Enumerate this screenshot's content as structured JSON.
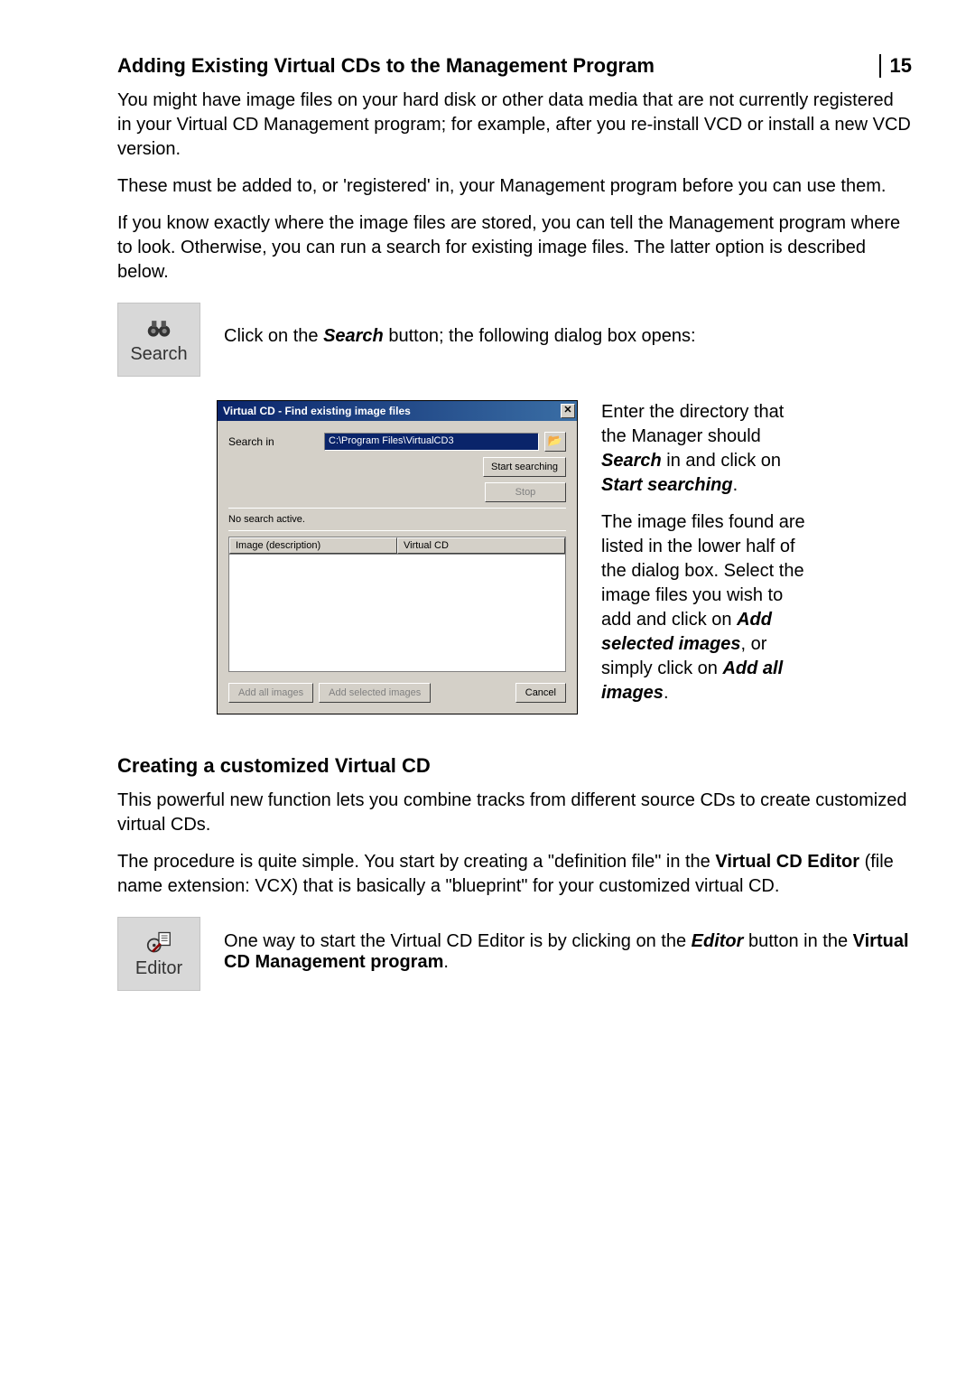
{
  "page": {
    "number": "15",
    "section1_title": "Adding Existing Virtual CDs to the Management Program",
    "section1_p1": "You might have image files on your hard disk or other data media that are not currently registered in your Virtual CD Management program; for example, after you re-install VCD or install a new VCD version.",
    "section1_p2": "These must be added to, or 'registered' in, your Management program before you can use them.",
    "section1_p3": "If you know exactly where the image files are stored, you can tell the Management program where to look. Otherwise, you can run a search for existing image files. The latter option is described below.",
    "search_button_label": "Search",
    "search_row_prefix": "Click on the ",
    "search_row_bold": "Search",
    "search_row_suffix": " button; the following dialog box opens:",
    "section2_title": "Creating a customized Virtual CD",
    "section2_p1": "This powerful new function lets you combine tracks from different source CDs to create customized virtual CDs.",
    "section2_p2a": "The procedure is quite simple. You start by creating a \"definition file\" in the ",
    "section2_p2b": "Virtual CD Editor",
    "section2_p2c": " (file name extension: VCX) that is basically a \"blueprint\" for your customized virtual CD.",
    "editor_button_label": "Editor",
    "editor_row_a": "One way to start the Virtual CD Editor is by clicking on the ",
    "editor_row_b": "Editor",
    "editor_row_c": " button in the ",
    "editor_row_d": "Virtual CD Management program",
    "editor_row_e": "."
  },
  "dialog": {
    "title": "Virtual CD - Find existing image files",
    "search_in_label": "Search in",
    "search_in_value": "C:\\Program Files\\VirtualCD3",
    "start_searching": "Start searching",
    "stop": "Stop",
    "status": "No search active.",
    "col1": "Image (description)",
    "col2": "Virtual CD",
    "add_all": "Add all images",
    "add_selected": "Add selected images",
    "cancel": "Cancel"
  },
  "sidetext": {
    "p1a": "Enter the directory that the Manager should ",
    "p1b": "Search",
    "p1c": " in and click on ",
    "p1d": "Start searching",
    "p1e": ".",
    "p2a": "The image files found are listed in the lower half of the dialog box. Select the image files you wish to add and click on ",
    "p2b": "Add selected images",
    "p2c": ", or simply click on ",
    "p2d": "Add all images",
    "p2e": "."
  }
}
